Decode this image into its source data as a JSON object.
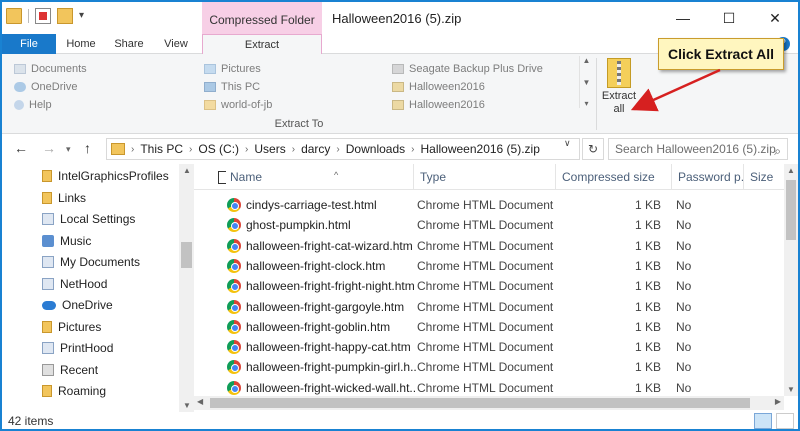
{
  "window": {
    "title": "Halloween2016 (5).zip",
    "contextual_tab_title": "Compressed Folder Tools",
    "minimize_glyph": "—",
    "maximize_glyph": "☐",
    "close_glyph": "✕"
  },
  "ribbon": {
    "tabs": [
      "File",
      "Home",
      "Share",
      "View",
      "Extract"
    ],
    "extract_to_group_label": "Extract To",
    "destinations": {
      "col1": [
        "Documents",
        "OneDrive",
        "Help"
      ],
      "col2": [
        "Pictures",
        "This PC",
        "world-of-jb"
      ],
      "col3": [
        "Seagate Backup Plus Drive",
        "Halloween2016",
        "Halloween2016"
      ]
    },
    "extract_all_label_1": "Extract",
    "extract_all_label_2": "all"
  },
  "callout": {
    "text": "Click Extract All"
  },
  "address": {
    "breadcrumbs": [
      "This PC",
      "OS (C:)",
      "Users",
      "darcy",
      "Downloads",
      "Halloween2016 (5).zip"
    ],
    "search_placeholder": "Search Halloween2016 (5).zip"
  },
  "nav_pane": {
    "items": [
      "IntelGraphicsProfiles",
      "Links",
      "Local Settings",
      "Music",
      "My Documents",
      "NetHood",
      "OneDrive",
      "Pictures",
      "PrintHood",
      "Recent",
      "Roaming"
    ]
  },
  "file_list": {
    "columns": [
      "Name",
      "Type",
      "Compressed size",
      "Password p...",
      "Size"
    ],
    "rows": [
      {
        "name": "cindys-carriage-test.html",
        "type": "Chrome HTML Document",
        "csize": "1 KB",
        "pwd": "No"
      },
      {
        "name": "ghost-pumpkin.html",
        "type": "Chrome HTML Document",
        "csize": "1 KB",
        "pwd": "No"
      },
      {
        "name": "halloween-fright-cat-wizard.htm",
        "type": "Chrome HTML Document",
        "csize": "1 KB",
        "pwd": "No"
      },
      {
        "name": "halloween-fright-clock.htm",
        "type": "Chrome HTML Document",
        "csize": "1 KB",
        "pwd": "No"
      },
      {
        "name": "halloween-fright-fright-night.htm",
        "type": "Chrome HTML Document",
        "csize": "1 KB",
        "pwd": "No"
      },
      {
        "name": "halloween-fright-gargoyle.htm",
        "type": "Chrome HTML Document",
        "csize": "1 KB",
        "pwd": "No"
      },
      {
        "name": "halloween-fright-goblin.htm",
        "type": "Chrome HTML Document",
        "csize": "1 KB",
        "pwd": "No"
      },
      {
        "name": "halloween-fright-happy-cat.htm",
        "type": "Chrome HTML Document",
        "csize": "1 KB",
        "pwd": "No"
      },
      {
        "name": "halloween-fright-pumpkin-girl.h...",
        "type": "Chrome HTML Document",
        "csize": "1 KB",
        "pwd": "No"
      },
      {
        "name": "halloween-fright-wicked-wall.ht...",
        "type": "Chrome HTML Document",
        "csize": "1 KB",
        "pwd": "No"
      }
    ]
  },
  "status": {
    "item_count": "42 items"
  },
  "colors": {
    "accent": "#1979ca",
    "contextual_tab": "#f7cfe6",
    "callout_fill": "#fff6bf",
    "arrow": "#d62020"
  }
}
